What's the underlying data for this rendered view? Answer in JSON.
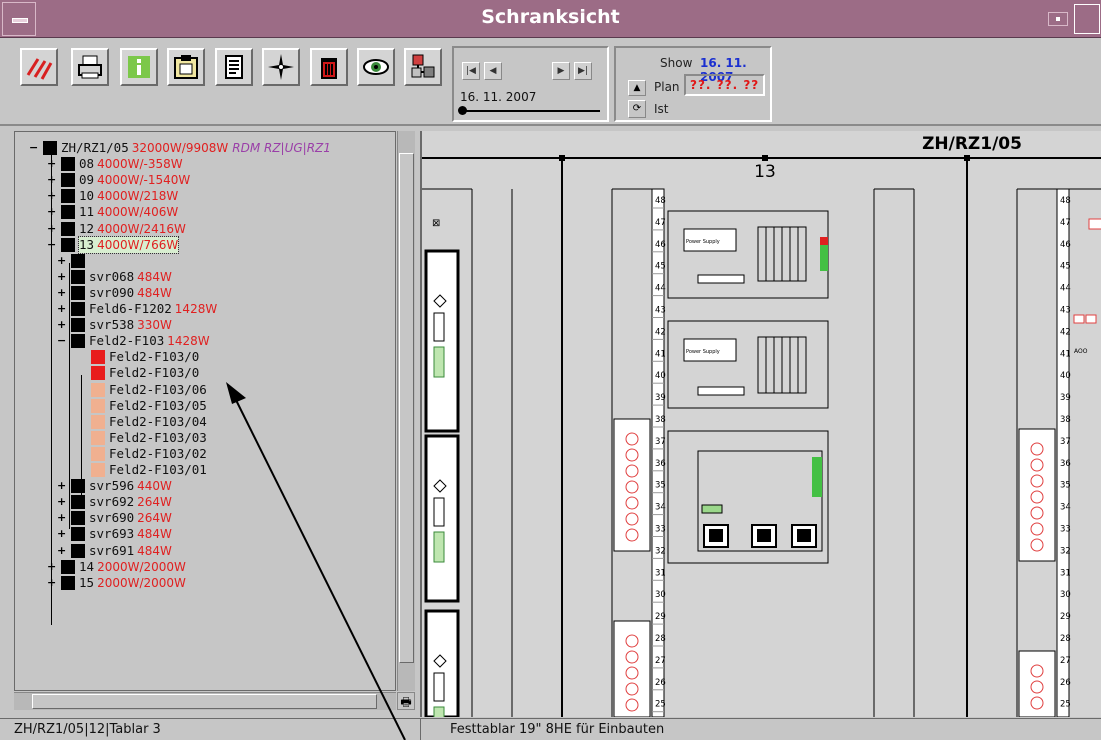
{
  "window": {
    "title": "Schranksicht"
  },
  "toolbar": {
    "buttons": [
      {
        "name": "hatch-icon",
        "label": ""
      },
      {
        "name": "printer-icon",
        "label": ""
      },
      {
        "name": "info-icon",
        "label": ""
      },
      {
        "name": "clipboard-icon",
        "label": ""
      },
      {
        "name": "document-icon",
        "label": ""
      },
      {
        "name": "compass-icon",
        "label": ""
      },
      {
        "name": "trash-icon",
        "label": ""
      },
      {
        "name": "eye-icon",
        "label": ""
      },
      {
        "name": "network-icon",
        "label": ""
      }
    ],
    "date_nav": {
      "date": "16. 11. 2007"
    },
    "show": {
      "label": "Show",
      "date": "16. 11. 2007",
      "plan_label": "Plan",
      "plan_value": "??. ??. ??",
      "ist_label": "Ist"
    }
  },
  "tree": {
    "root": {
      "label": "ZH/RZ1/05",
      "watt": "32000W/9908W",
      "path": "RDM RZ|UG|RZ1"
    },
    "racks": [
      {
        "label": "08",
        "watt": "4000W/-358W"
      },
      {
        "label": "09",
        "watt": "4000W/-1540W"
      },
      {
        "label": "10",
        "watt": "4000W/218W"
      },
      {
        "label": "11",
        "watt": "4000W/406W"
      },
      {
        "label": "12",
        "watt": "4000W/2416W"
      },
      {
        "label": "13",
        "watt": "4000W/766W"
      }
    ],
    "rack13_children": [
      {
        "label": "",
        "watt": ""
      },
      {
        "label": "svr068",
        "watt": "484W"
      },
      {
        "label": "svr090",
        "watt": "484W"
      },
      {
        "label": "Feld6-F1202",
        "watt": "1428W"
      },
      {
        "label": "svr538",
        "watt": "330W"
      },
      {
        "label": "Feld2-F103",
        "watt": "1428W"
      }
    ],
    "feld_children": [
      "Feld2-F103/0",
      "Feld2-F103/0",
      "Feld2-F103/06",
      "Feld2-F103/05",
      "Feld2-F103/04",
      "Feld2-F103/03",
      "Feld2-F103/02",
      "Feld2-F103/01"
    ],
    "rack13_after": [
      {
        "label": "svr596",
        "watt": "440W"
      },
      {
        "label": "svr692",
        "watt": "264W"
      },
      {
        "label": "svr690",
        "watt": "264W"
      },
      {
        "label": "svr693",
        "watt": "484W"
      },
      {
        "label": "svr691",
        "watt": "484W"
      }
    ],
    "racks_after": [
      {
        "label": "14",
        "watt": "2000W/2000W"
      },
      {
        "label": "15",
        "watt": "2000W/2000W"
      }
    ]
  },
  "cabinet": {
    "title": "ZH/RZ1/05",
    "rack_number": "13",
    "units_left": [
      "48",
      "47",
      "46",
      "45",
      "44",
      "43",
      "42",
      "41",
      "40",
      "39",
      "38",
      "37",
      "36",
      "35",
      "34",
      "33",
      "32",
      "31",
      "30",
      "29",
      "28",
      "27",
      "26",
      "25"
    ],
    "units_right": [
      "48",
      "47",
      "46",
      "45",
      "44",
      "43",
      "42",
      "41",
      "40",
      "39",
      "38",
      "37",
      "36",
      "35",
      "34",
      "33",
      "32",
      "31",
      "30",
      "29",
      "28",
      "27",
      "26",
      "25"
    ],
    "power_supply_label": "Power Supply",
    "aoo_label": "AOO"
  },
  "status": {
    "left": "ZH/RZ1/05|12|Tablar 3",
    "right": "Festtablar 19\" 8HE für Einbauten"
  },
  "colors": {
    "title_bar": "#9c6c86",
    "watt": "#e02020",
    "show_date": "#1a2fd0",
    "path": "#9a3fa8"
  }
}
